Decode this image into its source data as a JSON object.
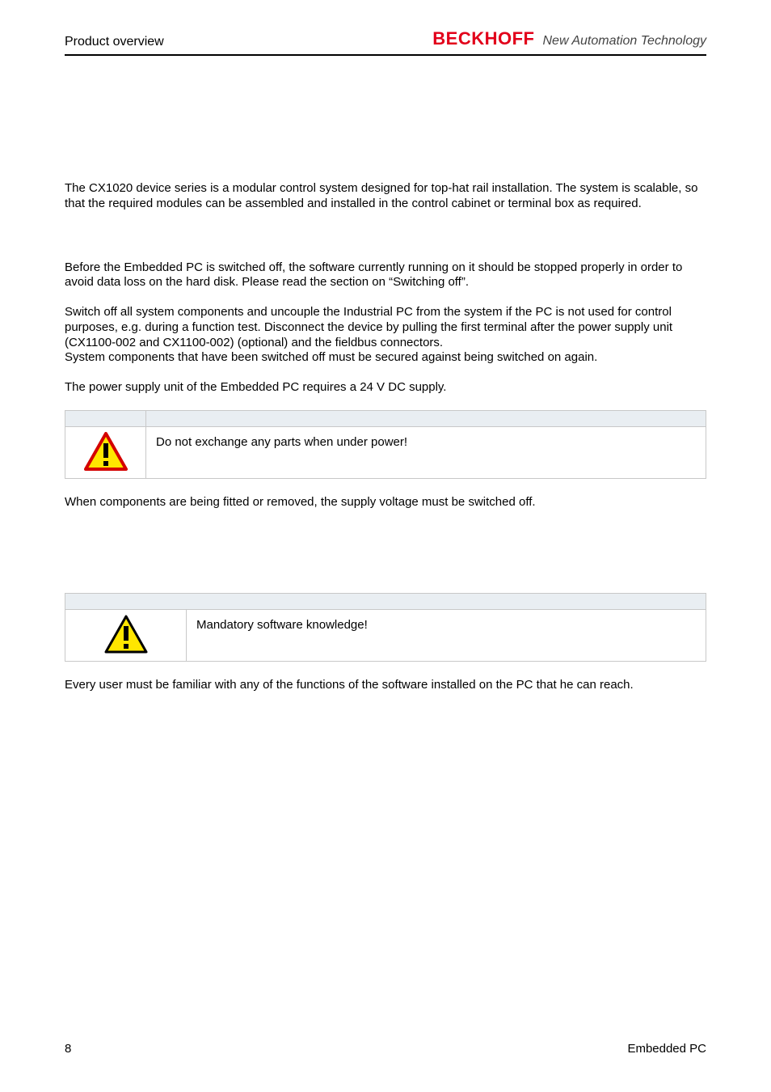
{
  "header": {
    "section": "Product overview",
    "brand": "BECKHOFF",
    "tagline": "New Automation Technology"
  },
  "body": {
    "intro": "The CX1020 device series is a modular control system designed for top-hat rail installation. The system is scalable, so that the required modules can be assembled and installed in the control cabinet or terminal box as required.",
    "p1": "Before the Embedded PC is switched off, the software currently running on it should be stopped properly in order to avoid data loss on the hard disk. Please read the section on “Switching off”.",
    "p2": "Switch off all system components and uncouple the Industrial PC from the system if the PC is not used for control purposes, e.g. during a function test. Disconnect the device by pulling the first terminal after the power supply unit (CX1100-002 and CX1100-002) (optional) and the fieldbus connectors.",
    "p3": "System components that have been switched off must be secured against being switched on again.",
    "p4": "The power supply unit of the Embedded PC requires a 24 V DC supply.",
    "callout1_text": "Do not exchange any parts when under power!",
    "p5": "When components are being fitted or removed, the supply voltage must be switched off.",
    "callout2_text": "Mandatory software knowledge!",
    "p6": "Every user must be familiar with any of the functions of the software installed on the PC that he can reach."
  },
  "footer": {
    "page": "8",
    "doc": "Embedded PC"
  },
  "icons": {
    "warning_red": "warning-icon",
    "warning_yellow": "caution-icon"
  }
}
